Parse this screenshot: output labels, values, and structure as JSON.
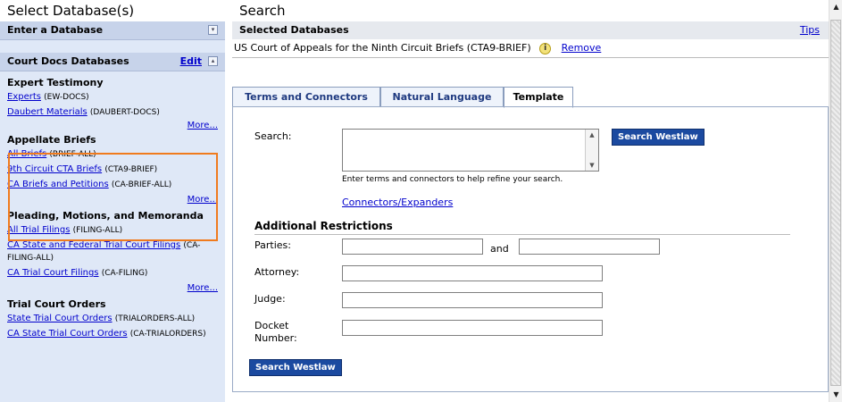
{
  "left": {
    "title": "Select Database(s)",
    "enter_bar": "Enter a Database",
    "court_bar": "Court Docs Databases",
    "edit_label": "Edit",
    "sections": [
      {
        "head": "Expert Testimony",
        "items": [
          {
            "text": "Experts",
            "code": "(EW-DOCS)"
          },
          {
            "text": "Daubert Materials",
            "code": "(DAUBERT-DOCS)"
          }
        ],
        "more": "More..."
      },
      {
        "head": "Appellate Briefs",
        "items": [
          {
            "text": "All Briefs",
            "code": "(BRIEF-ALL)"
          },
          {
            "text": "9th Circuit CTA Briefs",
            "code": "(CTA9-BRIEF)"
          },
          {
            "text": "CA Briefs and Petitions",
            "code": "(CA-BRIEF-ALL)"
          }
        ],
        "more": "More..."
      },
      {
        "head": "Pleading, Motions, and Memoranda",
        "items": [
          {
            "text": "All Trial Filings",
            "code": "(FILING-ALL)"
          },
          {
            "text": "CA State and Federal Trial Court Filings",
            "code": "(CA-FILING-ALL)"
          },
          {
            "text": "CA Trial Court Filings",
            "code": "(CA-FILING)"
          }
        ],
        "more": "More..."
      },
      {
        "head": "Trial Court Orders",
        "items": [
          {
            "text": "State Trial Court Orders",
            "code": "(TRIALORDERS-ALL)"
          },
          {
            "text": "CA State Trial Court Orders",
            "code": "(CA-TRIALORDERS)"
          }
        ],
        "more": ""
      }
    ]
  },
  "right": {
    "title": "Search",
    "selected_bar": "Selected Databases",
    "tips": "Tips",
    "db_name": "US Court of Appeals for the Ninth Circuit Briefs (CTA9-BRIEF)",
    "info_glyph": "i",
    "remove": "Remove",
    "tabs": [
      "Terms and Connectors",
      "Natural Language",
      "Template"
    ],
    "active_tab": "Template",
    "search_label": "Search:",
    "search_value": "",
    "search_hint": "Enter terms and connectors to help refine your search.",
    "connectors_link": "Connectors/Expanders",
    "search_button": "Search Westlaw",
    "additional_restrictions": "Additional Restrictions",
    "parties_label": "Parties:",
    "and_label": "and",
    "attorney_label": "Attorney:",
    "judge_label": "Judge:",
    "docket_label": "Docket Number:",
    "search_button_bottom": "Search Westlaw"
  },
  "icons": {
    "collapse": "▾",
    "collapse_up": "▴",
    "scroll_up": "▲",
    "scroll_down": "▼"
  }
}
